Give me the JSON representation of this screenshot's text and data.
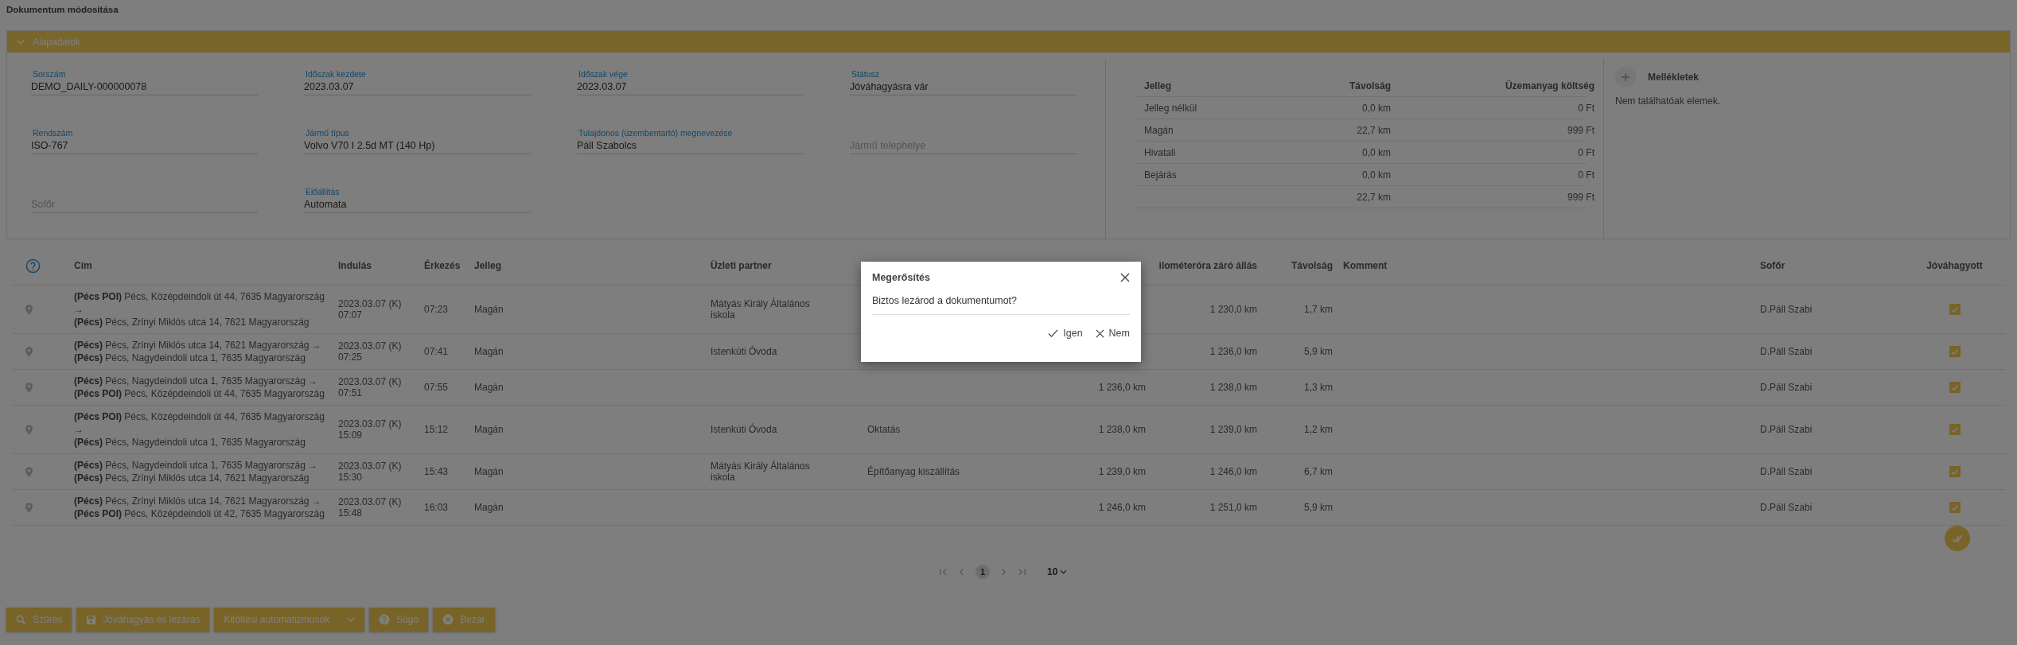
{
  "page_title": "Dokumentum módosítása",
  "panel": {
    "title": "Alapadatok",
    "expanded": true
  },
  "fields": [
    {
      "label": "Sorszám",
      "value": "DEMO_DAILY-000000078"
    },
    {
      "label": "Időszak kezdete",
      "value": "2023.03.07"
    },
    {
      "label": "Időszak vége",
      "value": "2023.03.07"
    },
    {
      "label": "Státusz",
      "value": "Jóváhagyásra vár"
    },
    {
      "label": "Rendszám",
      "value": "ISO-767"
    },
    {
      "label": "Jármű típus",
      "value": "Volvo V70 I 2.5d MT (140 Hp)"
    },
    {
      "label": "Tulajdonos (üzembentartó) megnevezése",
      "value": "Páll Szabolcs"
    },
    {
      "placeholder": "Jármű telephelye"
    },
    {
      "placeholder": "Sofőr"
    },
    {
      "label": "Előállítás",
      "value": "Automata"
    }
  ],
  "summary": {
    "columns": [
      "Jelleg",
      "Távolság",
      "Üzemanyag költség"
    ],
    "rows": [
      [
        "Jelleg nélkül",
        "0,0 km",
        "0 Ft"
      ],
      [
        "Magán",
        "22,7 km",
        "999 Ft"
      ],
      [
        "Hivatali",
        "0,0 km",
        "0 Ft"
      ],
      [
        "Bejárás",
        "0,0 km",
        "0 Ft"
      ],
      [
        "",
        "22,7 km",
        "999 Ft"
      ]
    ]
  },
  "attachments": {
    "title": "Mellékletek",
    "empty_text": "Nem találhatóak elemek."
  },
  "trips": {
    "columns": [
      {
        "label": "Cím"
      },
      {
        "label": "Indulás"
      },
      {
        "label": "Érkezés"
      },
      {
        "label": "Jelleg"
      },
      {
        "label": "Üzleti partner"
      },
      {},
      {},
      {
        "label": "ilométeróra záró állás"
      },
      {
        "label": "Távolság"
      },
      {
        "label": "Komment"
      },
      {
        "label": "Sofőr"
      },
      {
        "label": "Jóváhagyott"
      }
    ],
    "rows": [
      {
        "from": "**(Pécs POI)** Pécs, Középdeindoli út 44, 7635 Magyarország",
        "arrow": "→",
        "to": "**(Pécs)** Pécs, Zrínyi Miklós utca 14, 7621 Magyarország",
        "departure": "2023.03.07 (K) 07:07",
        "arrival": "07:23",
        "type": "Magán",
        "partner": "Mátyás Király Általános iskola",
        "km_end": "1 230,0 km",
        "distance": "1,7 km",
        "driver": "D.Páll Szabi",
        "approved": true
      },
      {
        "from": "**(Pécs)** Pécs, Zrínyi Miklós utca 14, 7621 Magyarország",
        "arrow": "→",
        "to": "**(Pécs)** Pécs, Nagydeindoli utca 1, 7635 Magyarország",
        "departure": "2023.03.07 (K) 07:25",
        "arrival": "07:41",
        "type": "Magán",
        "partner": "Istenkúti Óvoda",
        "km_end": "1 236,0 km",
        "distance": "5,9 km",
        "driver": "D.Páll Szabi",
        "approved": true
      },
      {
        "from": "**(Pécs)** Pécs, Nagydeindoli utca 1, 7635 Magyarország",
        "arrow": "→",
        "to": "**(Pécs POI)** Pécs, Középdeindoli út 44, 7635 Magyarország",
        "departure": "2023.03.07 (K) 07:51",
        "arrival": "07:55",
        "type": "Magán",
        "km_start": "1 236,0 km",
        "km_end": "1 238,0 km",
        "distance": "1,3 km",
        "driver": "D.Páll Szabi",
        "approved": true
      },
      {
        "from": "**(Pécs POI)** Pécs, Középdeindoli út 44, 7635 Magyarország",
        "arrow": "→",
        "to": "**(Pécs)** Pécs, Nagydeindoli utca 1, 7635 Magyarország",
        "departure": "2023.03.07 (K) 15:09",
        "arrival": "15:12",
        "type": "Magán",
        "partner": "Istenkúti Óvoda",
        "purpose": "Oktatás",
        "km_start": "1 238,0 km",
        "km_end": "1 239,0 km",
        "distance": "1,2 km",
        "driver": "D.Páll Szabi",
        "approved": true
      },
      {
        "from": "**(Pécs)** Pécs, Nagydeindoli utca 1, 7635 Magyarország",
        "arrow": "→",
        "to": "**(Pécs)** Pécs, Zrínyi Miklós utca 14, 7621 Magyarország",
        "departure": "2023.03.07 (K) 15:30",
        "arrival": "15:43",
        "type": "Magán",
        "partner": "Mátyás Király Általános iskola",
        "purpose": "Építőanyag kiszállítás",
        "km_start": "1 239,0 km",
        "km_end": "1 246,0 km",
        "distance": "6,7 km",
        "driver": "D.Páll Szabi",
        "approved": true
      },
      {
        "from": "**(Pécs)** Pécs, Zrínyi Miklós utca 14, 7621 Magyarország",
        "arrow": "→",
        "to": "**(Pécs POI)** Pécs, Középdeindoli út 42, 7635 Magyarország",
        "departure": "2023.03.07 (K) 15:48",
        "arrival": "16:03",
        "type": "Magán",
        "km_start": "1 246,0 km",
        "km_end": "1 251,0 km",
        "distance": "5,9 km",
        "driver": "D.Páll Szabi",
        "approved": true
      }
    ]
  },
  "pagination": {
    "pages": [
      {
        "label": "1",
        "selected": true
      }
    ],
    "page_size": "10"
  },
  "buttons": [
    {
      "kind": "search",
      "label": "Szűrés"
    },
    {
      "kind": "save",
      "label": "Jóváhagyás és lezárás"
    },
    {
      "kind": "dropdown",
      "label": "Kitöltési automatizmusok"
    },
    {
      "kind": "help",
      "label": "Súgó"
    },
    {
      "kind": "close",
      "label": "Bezár"
    }
  ],
  "dialog": {
    "title": "Megerősítés",
    "message": "Biztos lezárod a dokumentumot?",
    "buttons": [
      {
        "kind": "confirm",
        "label": "Igen"
      },
      {
        "kind": "cancel",
        "label": "Nem"
      }
    ]
  }
}
